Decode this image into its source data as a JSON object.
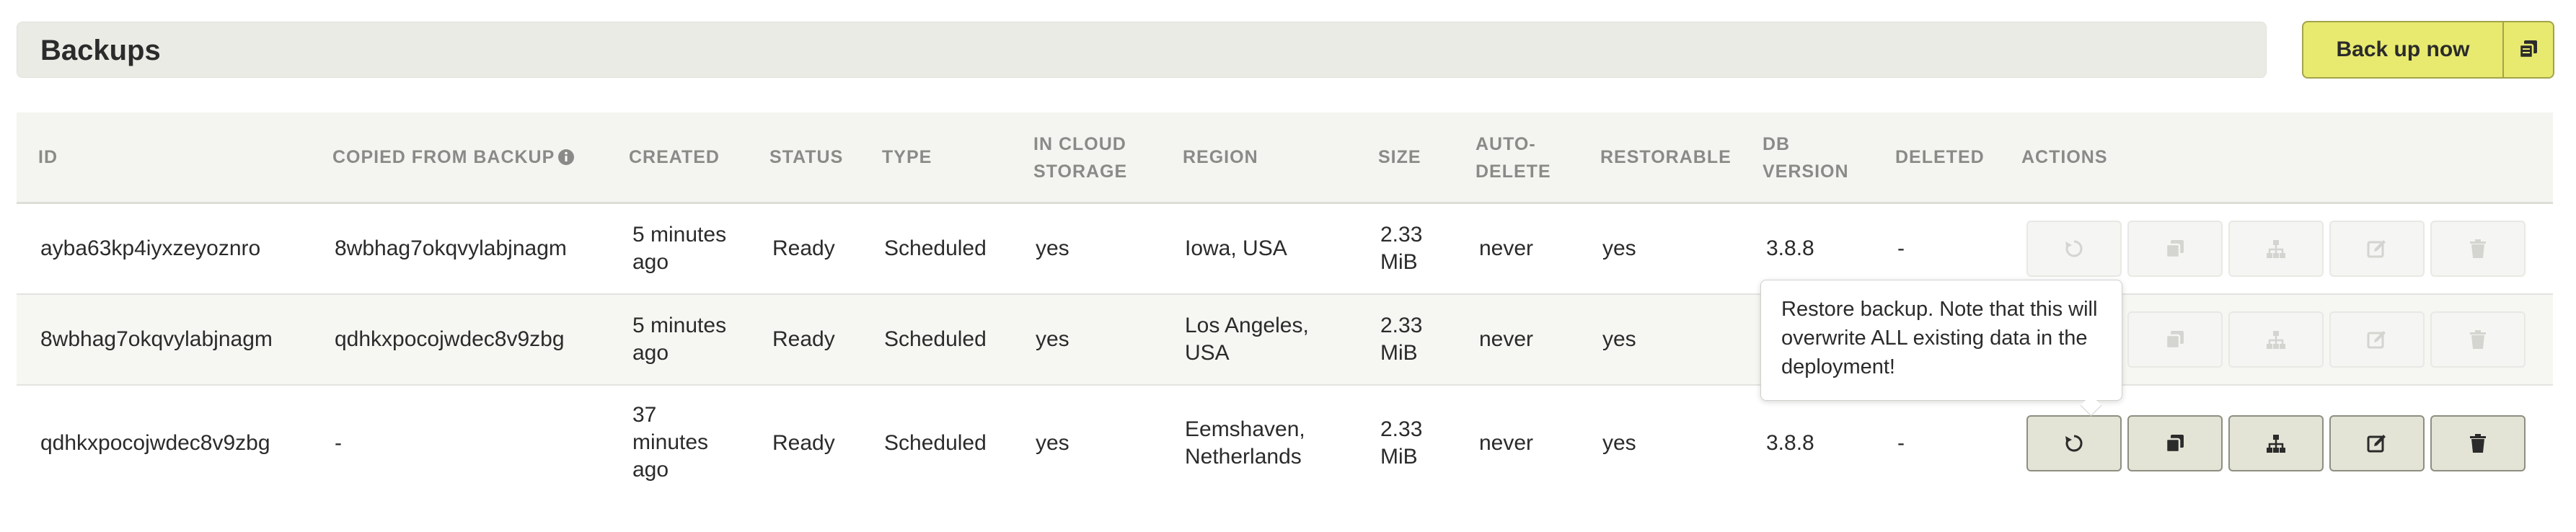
{
  "header": {
    "title": "Backups",
    "backup_button_label": "Back up now",
    "backup_button_icon": "copy-icon"
  },
  "table": {
    "columns": {
      "id": "ID",
      "copied_from": "COPIED FROM BACKUP",
      "created": "CREATED",
      "status": "STATUS",
      "type": "TYPE",
      "in_cloud_line1": "IN CLOUD",
      "in_cloud_line2": "STORAGE",
      "region": "REGION",
      "size": "SIZE",
      "auto_delete_line1": "AUTO-",
      "auto_delete_line2": "DELETE",
      "restorable": "RESTORABLE",
      "db_version_line1": "DB",
      "db_version_line2": "VERSION",
      "deleted": "DELETED",
      "actions": "ACTIONS"
    },
    "rows": [
      {
        "id": "ayba63kp4iyxzeyoznro",
        "copied_from": "8wbhag7okqvylabjnagm",
        "created_line1": "5 minutes",
        "created_line2": "ago",
        "status": "Ready",
        "type": "Scheduled",
        "in_cloud": "yes",
        "region_line1": "Iowa, USA",
        "size_line1": "2.33",
        "size_line2": "MiB",
        "auto_delete": "never",
        "restorable": "yes",
        "db_version": "3.8.8",
        "deleted": "-",
        "actions_enabled": false
      },
      {
        "id": "8wbhag7okqvylabjnagm",
        "copied_from": "qdhkxpocojwdec8v9zbg",
        "created_line1": "5 minutes",
        "created_line2": "ago",
        "status": "Ready",
        "type": "Scheduled",
        "in_cloud": "yes",
        "region_line1": "Los Angeles,",
        "region_line2": "USA",
        "size_line1": "2.33",
        "size_line2": "MiB",
        "auto_delete": "never",
        "restorable": "yes",
        "actions_enabled": false
      },
      {
        "id": "qdhkxpocojwdec8v9zbg",
        "copied_from": "-",
        "created_line1": "37",
        "created_line2": "minutes",
        "created_line3": "ago",
        "status": "Ready",
        "type": "Scheduled",
        "in_cloud": "yes",
        "region_line1": "Eemshaven,",
        "region_line2": "Netherlands",
        "size_line1": "2.33",
        "size_line2": "MiB",
        "auto_delete": "never",
        "restorable": "yes",
        "db_version": "3.8.8",
        "deleted": "-",
        "actions_enabled": true
      }
    ],
    "action_icons": [
      "restore-icon",
      "copy-icon",
      "clone-deployment-icon",
      "edit-icon",
      "delete-icon"
    ]
  },
  "tooltip": {
    "text": "Restore backup. Note that this will overwrite ALL existing data in the deployment!"
  },
  "colors": {
    "primary_button": "#e7ea6f",
    "header_bg": "#ebebe6",
    "action_enabled": "#e4e4d6"
  }
}
